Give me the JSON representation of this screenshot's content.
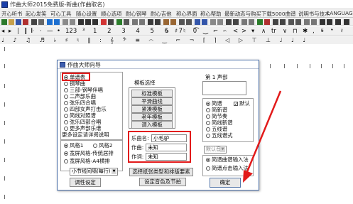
{
  "window": {
    "title": "作曲大师2015免费版-新曲(作曲取名)"
  },
  "menu": [
    "开心听书",
    "起心发笑",
    "可心工具",
    "随心设置",
    "顺心选项",
    "耐心钢琴",
    "耐心吉他",
    "称心界面",
    "称心帮助",
    "最新动态与购买",
    "下载5000曲谱",
    "说明书与技术",
    "LANGUAGE"
  ],
  "toolbar2": {
    "digits": "1 2 3 4 5 6 7 0",
    "count": "123"
  },
  "toolbar3": {
    "symbols": "♩ ♪ ♫ ♬ ♭ ♯ ♮ ‖ : 𝄞 𝄢 ≡ ⌒ ‿ ⌐ ¬ ⌈ ⌉ ◁ ▷ ⊤ ⊥ ♩ ♩ ♩"
  },
  "dialog": {
    "title": "作曲大师向导",
    "score_types": [
      "单谱表",
      "钢琴曲",
      "三部-钢琴伴唱",
      "二声部乐曲",
      "弦乐四合唱",
      "四部女声打击乐",
      "简线对照谱",
      "弦乐四部合唱",
      "更多声部乐谱",
      "更多设定请详阅说明"
    ],
    "style_label1": "风格1",
    "style_label2": "风格2",
    "style_opt1": "宽屏风格-传统居排",
    "style_opt2": "宽屏风格-A4横排",
    "small_select": "小节线间隔(每行)",
    "adjust_btn": "调性设定",
    "template_header": "模板选择",
    "templates": [
      "标准模板",
      "平滑曲线",
      "紧凑模板",
      "老年模板",
      "调入模板"
    ],
    "song_name_label": "乐曲名:",
    "song_name_value": "小毛驴",
    "composer_label": "作曲:",
    "composer_value": "未知",
    "lyricist_label": "作词:",
    "lyricist_value": "未知",
    "select_type_btn": "选择纸张类型和排版要素",
    "set_tone_btn": "设定音色及节拍",
    "voice_header": "第 1 声部",
    "notation_types": [
      "简谱",
      "简新谱",
      "简节奏",
      "简线新谱",
      "五线谱",
      "五线谱式"
    ],
    "default_label": "默认",
    "voice_select": "默认音",
    "mode_options": [
      "简谱曲谱输入法",
      "简谱点击输入法"
    ],
    "ok_btn": "确定"
  },
  "colors": {
    "accent_red": "#e21a1a",
    "dialog_border": "#4a6fa8"
  }
}
